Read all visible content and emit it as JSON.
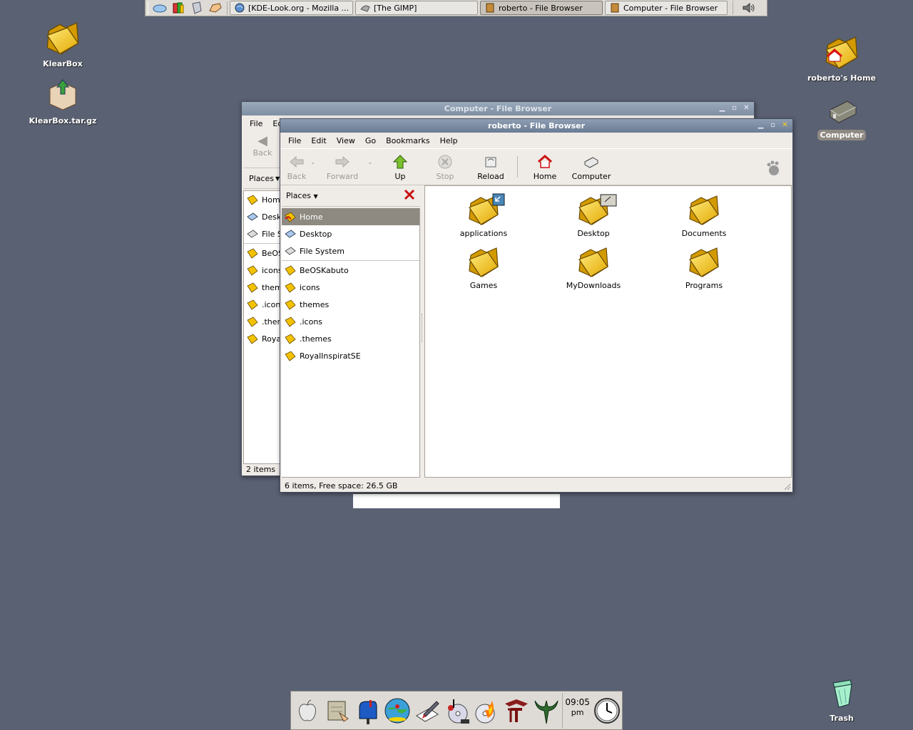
{
  "taskbar": {
    "launchers": [
      "cloud-icon",
      "colorful-books-icon",
      "shield-icon",
      "hand-icon"
    ],
    "tasks": [
      {
        "label": "[KDE-Look.org - Mozilla ...",
        "icon": "globe-icon",
        "active": false
      },
      {
        "label": "[The GIMP]",
        "icon": "gimp-icon",
        "active": false
      },
      {
        "label": "roberto - File Browser",
        "icon": "file-browser-icon",
        "active": true
      },
      {
        "label": "Computer - File Browser",
        "icon": "file-browser-icon",
        "active": false
      }
    ],
    "tray_icon": "volume-icon"
  },
  "desktop": {
    "icons": [
      {
        "label": "KlearBox",
        "icon": "folder-icon"
      },
      {
        "label": "KlearBox.tar.gz",
        "icon": "package-icon"
      },
      {
        "label": "roberto's Home",
        "icon": "home-folder-icon"
      },
      {
        "label": "Computer",
        "icon": "hard-drive-icon"
      },
      {
        "label": "Trash",
        "icon": "trash-icon"
      }
    ]
  },
  "back_window": {
    "title": "Computer - File Browser",
    "menu": [
      "File",
      "Ed"
    ],
    "back_label": "Back",
    "places_label": "Places",
    "places": [
      "Hom",
      "Desk",
      "File S",
      "BeOS",
      "icons",
      "them",
      ".icon",
      ".then",
      "Roya"
    ],
    "status": "2 items"
  },
  "front_window": {
    "title": "roberto - File Browser",
    "menu": [
      "File",
      "Edit",
      "View",
      "Go",
      "Bookmarks",
      "Help"
    ],
    "toolbar": {
      "back": "Back",
      "forward": "Forward",
      "up": "Up",
      "stop": "Stop",
      "reload": "Reload",
      "home": "Home",
      "computer": "Computer"
    },
    "places_label": "Places",
    "places_top": [
      "Home",
      "Desktop",
      "File System"
    ],
    "places_bookmarks": [
      "BeOSKabuto",
      "icons",
      "themes",
      ".icons",
      ".themes",
      "RoyalInspiratSE"
    ],
    "files": [
      "applications",
      "Desktop",
      "Documents",
      "Games",
      "MyDownloads",
      "Programs"
    ],
    "status": "6 items, Free space: 26.5 GB"
  },
  "dock": {
    "icons": [
      "apple-icon",
      "file-manager-icon",
      "mailbox-icon",
      "globe-surfer-icon",
      "pen-paper-icon",
      "music-cd-icon",
      "burn-disc-icon",
      "et-game-icon",
      "quake-icon"
    ],
    "clock_time": "09:05",
    "clock_ampm": "pm",
    "analog_clock_icon": "analog-clock-icon"
  },
  "colors": {
    "desktop": "#5a6173",
    "selection": "#8e8a82",
    "titlebar_active": "#6a7b93",
    "folder": "#f5c400"
  }
}
